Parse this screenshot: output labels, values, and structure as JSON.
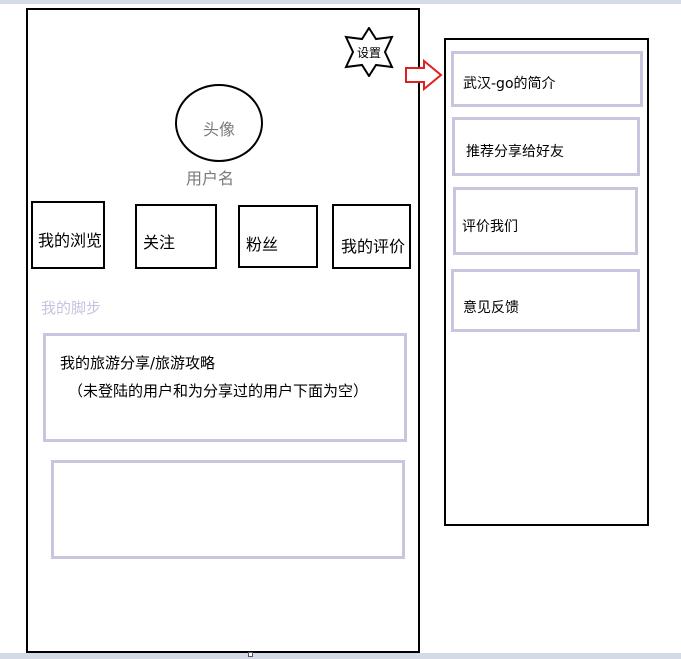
{
  "settings": {
    "label": "设置"
  },
  "profile": {
    "avatar_label": "头像",
    "username": "用户名"
  },
  "tabs": [
    {
      "label": "我的浏览"
    },
    {
      "label": "关注"
    },
    {
      "label": "粉丝"
    },
    {
      "label": "我的评价"
    }
  ],
  "footprint": {
    "title": "我的脚步",
    "share_title": "我的旅游分享/旅游攻略",
    "share_note": "（未登陆的用户和为分享过的用户下面为空）"
  },
  "side_menu": {
    "items": [
      {
        "label": "武汉-go的简介"
      },
      {
        "label": "推荐分享给好友"
      },
      {
        "label": "评价我们"
      },
      {
        "label": "意见反馈"
      }
    ]
  },
  "colors": {
    "outline": "#000000",
    "card_border": "#cac4de",
    "footprint_text": "#c8c2e0",
    "muted_text": "#7a7a7a",
    "arrow": "#e02020"
  }
}
